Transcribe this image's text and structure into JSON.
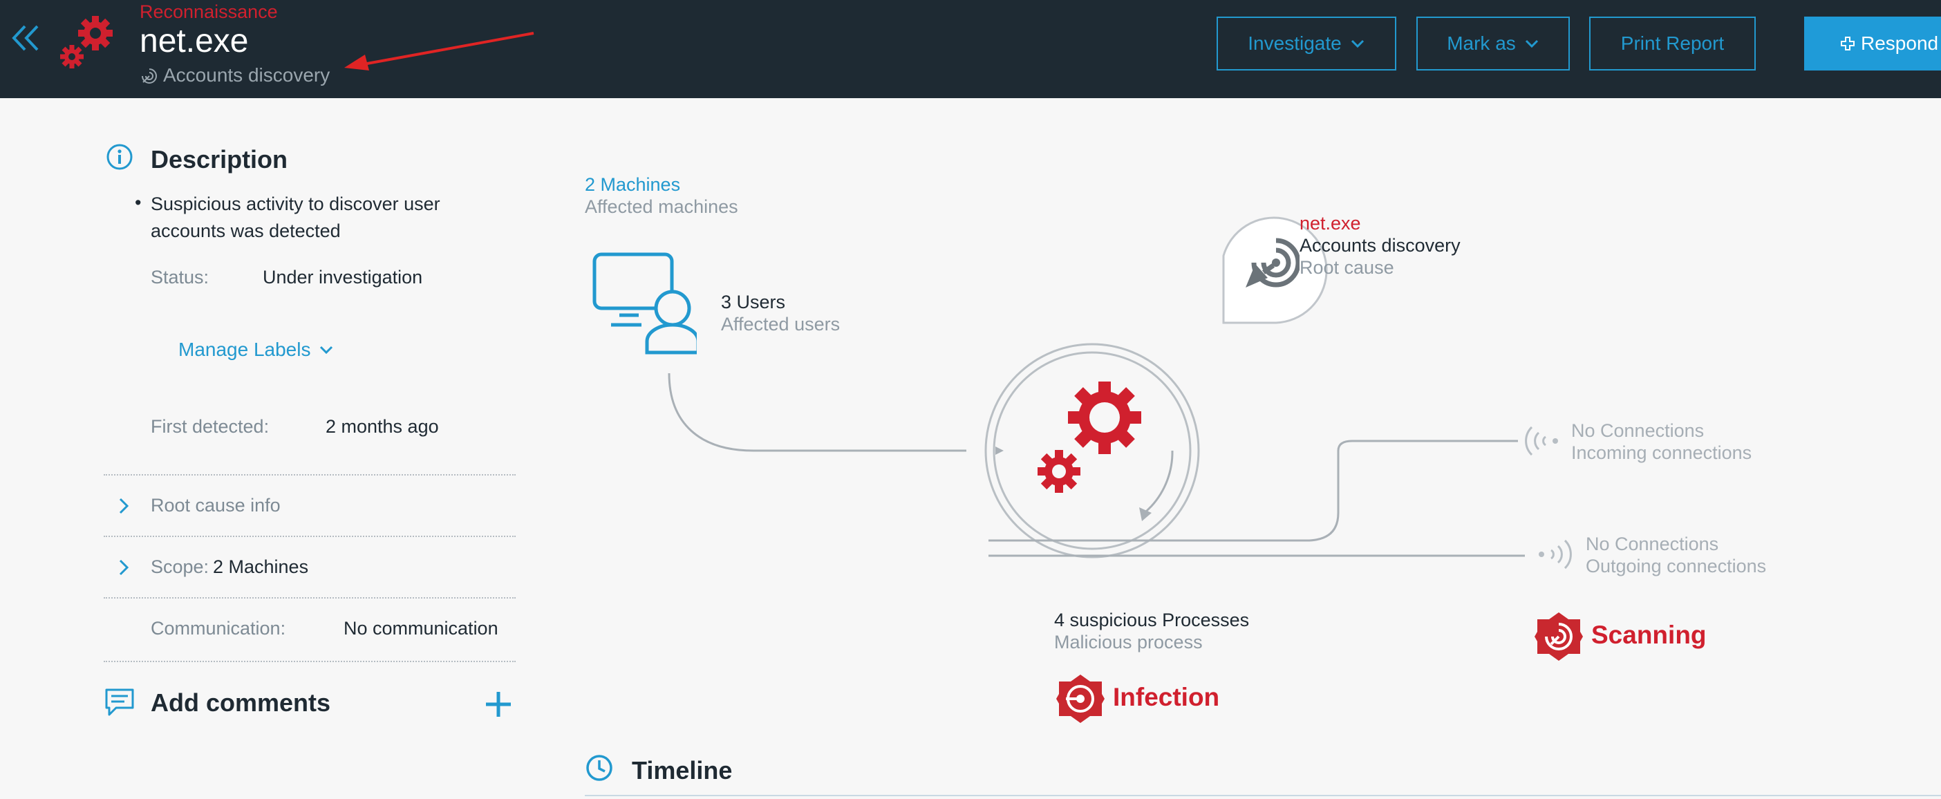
{
  "header": {
    "category": "Reconnaissance",
    "title": "net.exe",
    "subtitle": "Accounts discovery",
    "buttons": {
      "investigate": "Investigate",
      "mark_as": "Mark as",
      "print_report": "Print Report",
      "respond": "Respond"
    }
  },
  "colors": {
    "header_bg": "#1e2a33",
    "accent": "#2299cf",
    "danger": "#d0202e",
    "page_bg": "#f7f7f7"
  },
  "description": {
    "title": "Description",
    "bullet_line1": "Suspicious activity to discover user",
    "bullet_line2": "accounts was detected",
    "status_label": "Status:",
    "status_value": "Under investigation",
    "manage_labels": "Manage Labels",
    "first_detected_label": "First detected:",
    "first_detected_value": "2 months ago",
    "root_cause_info": "Root cause info",
    "scope_label": "Scope:",
    "scope_value": "2 Machines",
    "communication_label": "Communication:",
    "communication_value": "No communication"
  },
  "comments": {
    "title": "Add comments"
  },
  "graph": {
    "machines_count": "2 Machines",
    "machines_label": "Affected machines",
    "users_count": "3 Users",
    "users_label": "Affected users",
    "root_cause_name": "net.exe",
    "root_cause_title": "Accounts discovery",
    "root_cause_label": "Root cause",
    "incoming_title": "No Connections",
    "incoming_label": "Incoming connections",
    "outgoing_title": "No Connections",
    "outgoing_label": "Outgoing connections",
    "processes_title": "4 suspicious Processes",
    "processes_label": "Malicious process",
    "infection_badge": "Infection",
    "scanning_badge": "Scanning"
  },
  "timeline": {
    "title": "Timeline"
  }
}
